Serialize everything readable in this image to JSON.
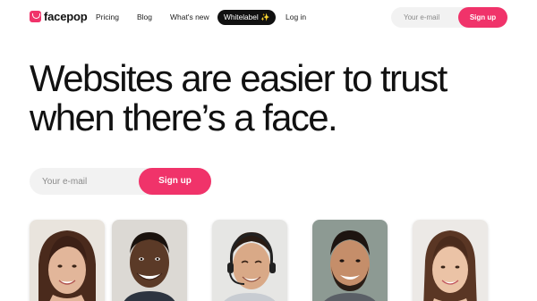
{
  "brand": {
    "name": "facepop",
    "accent": "#f0336a"
  },
  "nav": {
    "links": [
      "Pricing",
      "Blog",
      "What's new"
    ],
    "whitelabel": "Whitelabel ✨",
    "login": "Log in"
  },
  "top_signup": {
    "placeholder": "Your e-mail",
    "button": "Sign up"
  },
  "hero": {
    "headline_line1": "Websites are easier to trust",
    "headline_line2": "when there’s a face.",
    "email_placeholder": "Your e-mail",
    "button": "Sign up"
  },
  "faces": [
    {
      "name": "woman-long-hair"
    },
    {
      "name": "man-smiling"
    },
    {
      "name": "man-headset"
    },
    {
      "name": "man-beard"
    },
    {
      "name": "woman-smiling"
    }
  ]
}
